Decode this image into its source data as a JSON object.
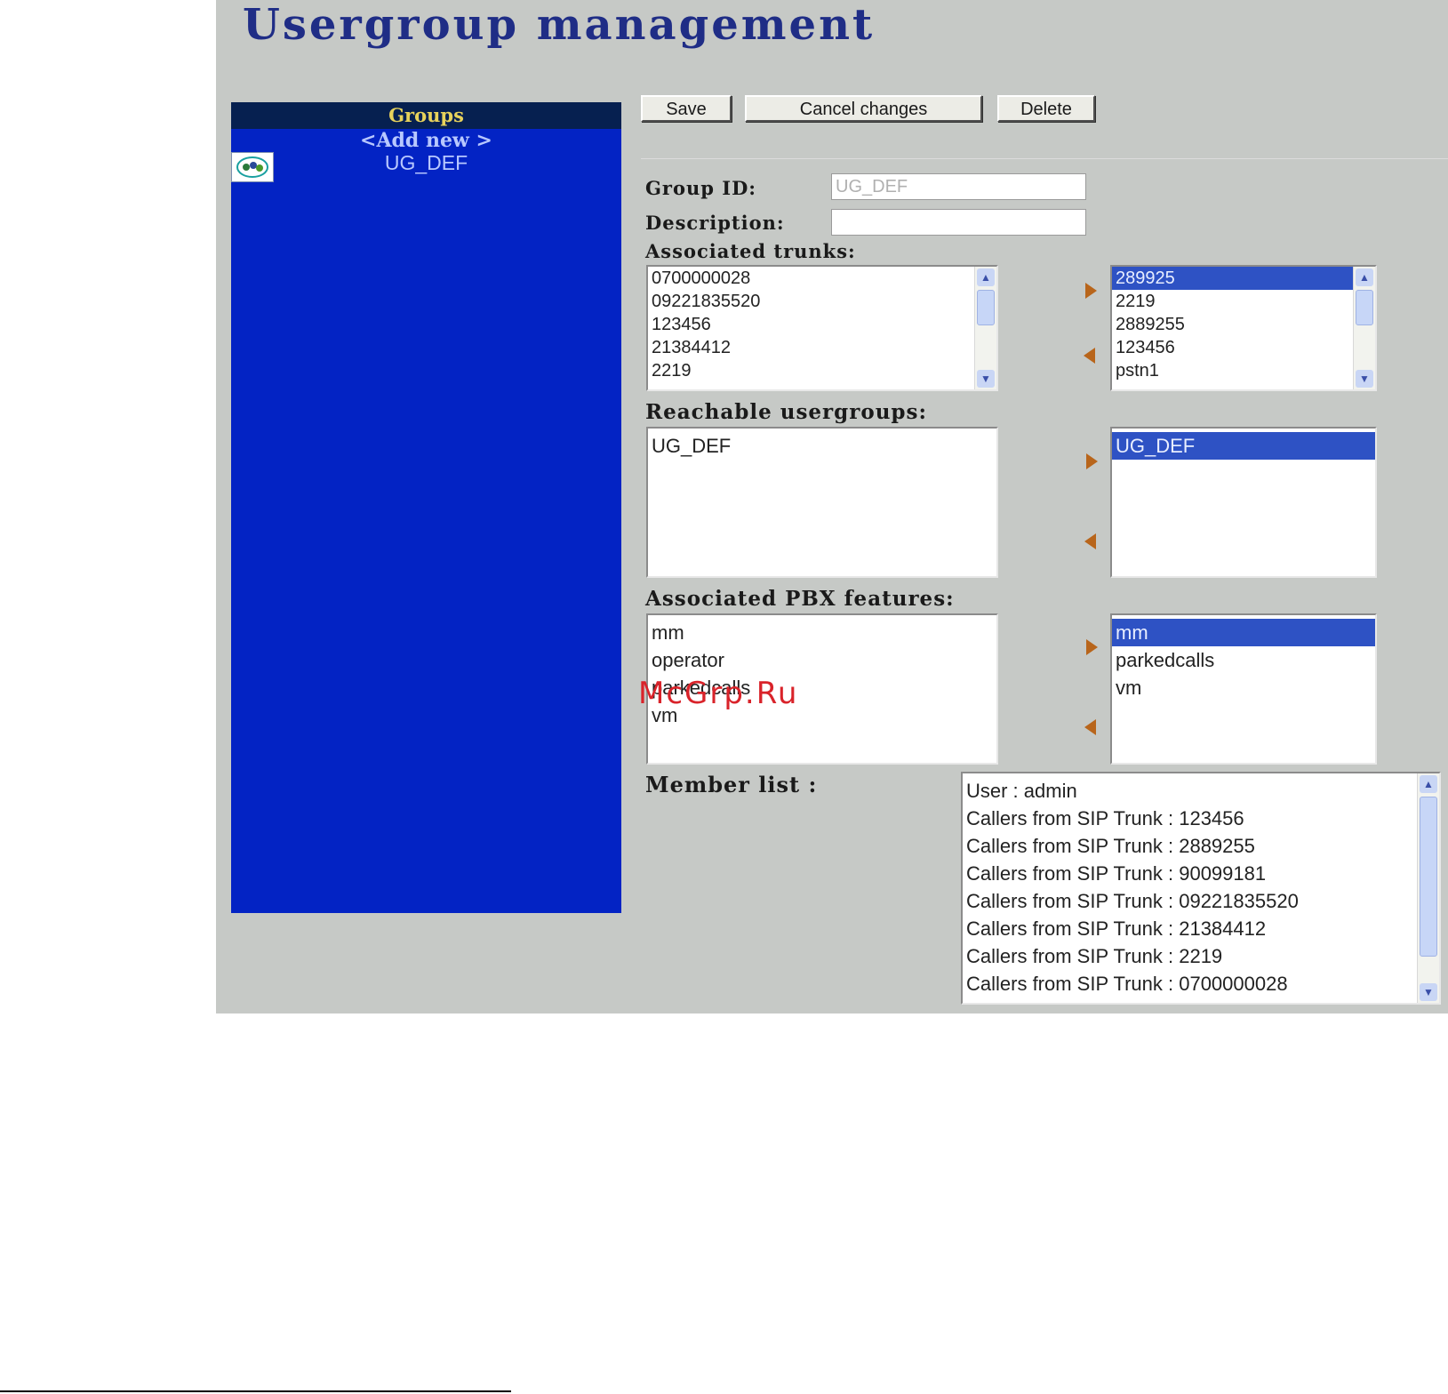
{
  "page": {
    "title": "Usergroup management"
  },
  "groups_panel": {
    "header": "Groups",
    "add_new": "<Add new >",
    "items": [
      {
        "label": "UG_DEF",
        "icon": "group-icon"
      }
    ]
  },
  "toolbar": {
    "save_label": "Save",
    "cancel_label": "Cancel changes",
    "delete_label": "Delete"
  },
  "form": {
    "group_id_label": "Group ID:",
    "group_id_value": "UG_DEF",
    "description_label": "Description:",
    "description_value": "",
    "trunks_label": "Associated trunks:",
    "trunks_available": [
      "0700000028",
      "09221835520",
      "123456",
      "21384412",
      "2219"
    ],
    "trunks_selected": [
      "289925",
      "2219",
      "2889255",
      "123456",
      "pstn1"
    ],
    "usergroups_label": "Reachable usergroups:",
    "usergroups_available": [
      "UG_DEF"
    ],
    "usergroups_selected": [
      "UG_DEF"
    ],
    "pbx_label": "Associated PBX features:",
    "pbx_available": [
      "mm",
      "operator",
      "parkedcalls",
      "vm"
    ],
    "pbx_selected": [
      "mm",
      "parkedcalls",
      "vm"
    ],
    "members_label": "Member list :",
    "members": [
      "User : admin",
      "Callers from SIP Trunk : 123456",
      "Callers from SIP Trunk : 2889255",
      "Callers from SIP Trunk : 90099181",
      "Callers from SIP Trunk : 09221835520",
      "Callers from SIP Trunk : 21384412",
      "Callers from SIP Trunk : 2219",
      "Callers from SIP Trunk : 0700000028"
    ]
  },
  "watermark": "McGrp.Ru",
  "colors": {
    "panel": "#0323c4",
    "header": "#062050",
    "selection": "#2e52c4",
    "arrow": "#b8651b",
    "title": "#1f2d86"
  }
}
